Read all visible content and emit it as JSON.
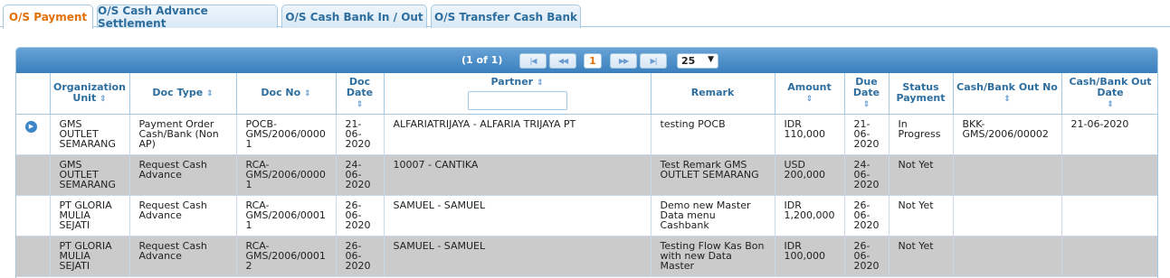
{
  "tabs": [
    {
      "label": "O/S Payment",
      "active": true
    },
    {
      "label": "O/S Cash Advance Settlement",
      "active": false
    },
    {
      "label": "O/S Cash Bank In / Out",
      "active": false
    },
    {
      "label": "O/S Transfer Cash Bank",
      "active": false
    }
  ],
  "pager": {
    "info": "(1 of 1)",
    "first": "|◀",
    "prev": "◀◀",
    "current_page": "1",
    "next": "▶▶",
    "last": "▶|",
    "page_size": "25"
  },
  "columns": {
    "org_unit": "Organization Unit",
    "doc_type": "Doc Type",
    "doc_no": "Doc No",
    "doc_date": "Doc Date",
    "partner": "Partner",
    "remark": "Remark",
    "amount": "Amount",
    "due_date": "Due Date",
    "status_payment": "Status Payment",
    "cb_out_no": "Cash/Bank Out No",
    "cb_out_date": "Cash/Bank Out Date"
  },
  "partner_filter_value": "",
  "sort_glyph": "⇕",
  "rows": [
    {
      "org": "GMS OUTLET SEMARANG",
      "type": "Payment Order Cash/Bank (Non AP)",
      "no": "POCB-GMS/2006/00001",
      "date": "21-06-2020",
      "partner": "ALFARIATRIJAYA - ALFARIA TRIJAYA PT",
      "remark": "testing POCB",
      "amount": "IDR 110,000",
      "due": "21-06-2020",
      "status": "In Progress",
      "cbno": "BKK-GMS/2006/00002",
      "cbdate": "21-06-2020"
    },
    {
      "org": "GMS OUTLET SEMARANG",
      "type": "Request Cash Advance",
      "no": "RCA-GMS/2006/00001",
      "date": "24-06-2020",
      "partner": "10007 - CANTIKA",
      "remark": "Test Remark GMS OUTLET SEMARANG",
      "amount": "USD 200,000",
      "due": "24-06-2020",
      "status": "Not Yet",
      "cbno": "",
      "cbdate": ""
    },
    {
      "org": "PT GLORIA MULIA SEJATI",
      "type": "Request Cash Advance",
      "no": "RCA-GMS/2006/00011",
      "date": "26-06-2020",
      "partner": "SAMUEL - SAMUEL",
      "remark": "Demo new Master Data menu Cashbank",
      "amount": "IDR 1,200,000",
      "due": "26-06-2020",
      "status": "Not Yet",
      "cbno": "",
      "cbdate": ""
    },
    {
      "org": "PT GLORIA MULIA SEJATI",
      "type": "Request Cash Advance",
      "no": "RCA-GMS/2006/00012",
      "date": "26-06-2020",
      "partner": "SAMUEL - SAMUEL",
      "remark": "Testing Flow Kas Bon with new Data Master",
      "amount": "IDR 100,000",
      "due": "26-06-2020",
      "status": "Not Yet",
      "cbno": "",
      "cbdate": ""
    }
  ]
}
